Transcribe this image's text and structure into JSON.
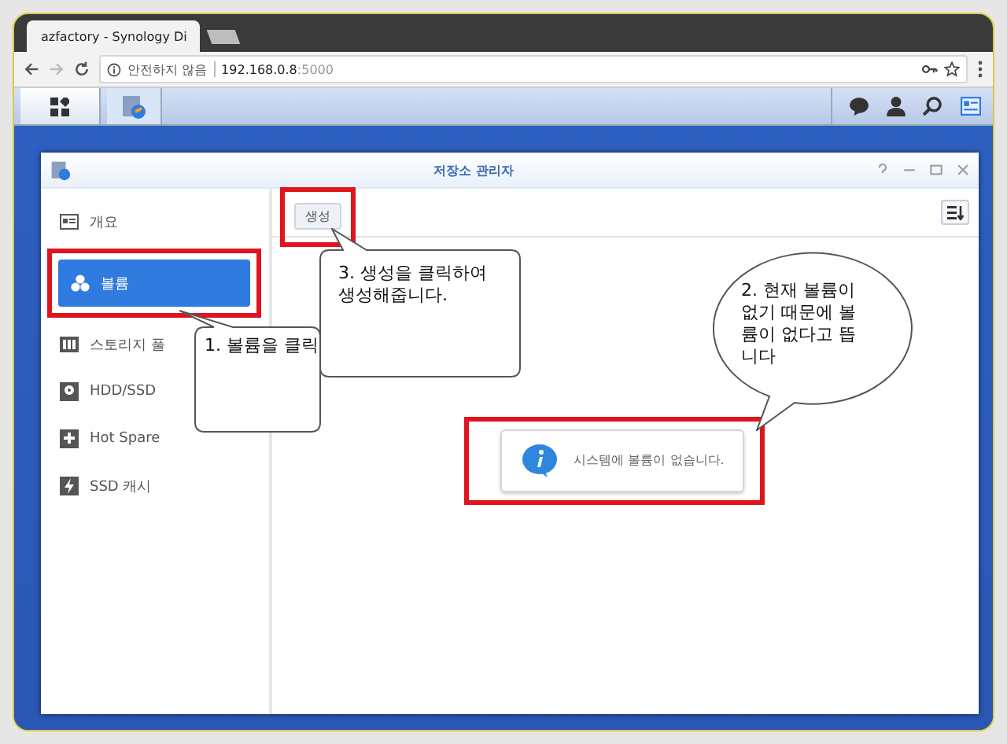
{
  "browser": {
    "tab": {
      "title": "azfactory - Synology Di"
    },
    "address": {
      "security": "안전하지 않음",
      "host": "192.168.0.8",
      "port": ":5000"
    }
  },
  "app": {
    "title": "저장소 관리자",
    "sidebar": [
      {
        "label": "개요",
        "selected": false
      },
      {
        "label": "볼륨",
        "selected": true
      },
      {
        "label": "스토리지 풀",
        "selected": false
      },
      {
        "label": "HDD/SSD",
        "selected": false
      },
      {
        "label": "Hot Spare",
        "selected": false
      },
      {
        "label": "SSD 캐시",
        "selected": false
      }
    ],
    "toolbar": {
      "create": "생성"
    },
    "message": "시스템에 볼륨이 없습니다."
  },
  "annotations": [
    {
      "kind": "box",
      "lines": [
        "1. 볼륨을 클릭"
      ]
    },
    {
      "kind": "box",
      "lines": [
        "3. 생성을 클릭하여",
        "생성해줍니다."
      ]
    },
    {
      "kind": "ellipse",
      "lines": [
        "2. 현재 볼륨이",
        "없기 때문에 볼",
        "륨이 없다고 뜹",
        "니다"
      ]
    }
  ]
}
